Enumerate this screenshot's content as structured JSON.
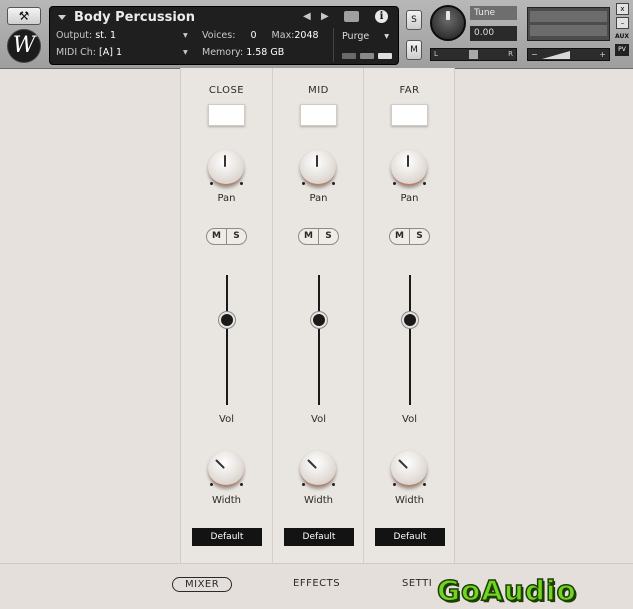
{
  "header": {
    "instrument_name": "Body Percussion",
    "logo_letter": "W",
    "wrench_icon": "wrench-icon",
    "output_label": "Output:",
    "output_value": "st. 1",
    "midi_label": "MIDI Ch:",
    "midi_value": "[A]  1",
    "voices_label": "Voices:",
    "voices_value": "0",
    "max_label": "Max:",
    "max_value": "2048",
    "memory_label": "Memory:",
    "memory_value": "1.58 GB",
    "purge_label": "Purge",
    "solo_label": "S",
    "mute_label": "M",
    "tune_label": "Tune",
    "tune_value": "0.00",
    "pan_left": "L",
    "pan_right": "R",
    "vol_minus": "−",
    "vol_plus": "+",
    "close_label": "x",
    "aux_label": "AUX",
    "pv_label": "PV"
  },
  "channels": [
    {
      "title": "CLOSE",
      "pan_label": "Pan",
      "vol_label": "Vol",
      "width_label": "Width",
      "preset": "Default",
      "mute": "M",
      "solo": "S"
    },
    {
      "title": "MID",
      "pan_label": "Pan",
      "vol_label": "Vol",
      "width_label": "Width",
      "preset": "Default",
      "mute": "M",
      "solo": "S"
    },
    {
      "title": "FAR",
      "pan_label": "Pan",
      "vol_label": "Vol",
      "width_label": "Width",
      "preset": "Default",
      "mute": "M",
      "solo": "S"
    }
  ],
  "tabs": {
    "mixer": "MIXER",
    "effects": "EFFECTS",
    "settings": "SETTI"
  },
  "watermark": "GoAudio",
  "colors": {
    "background": "#e6e1dc",
    "header": "#a8a8a8",
    "watermark": "#6fd520"
  }
}
